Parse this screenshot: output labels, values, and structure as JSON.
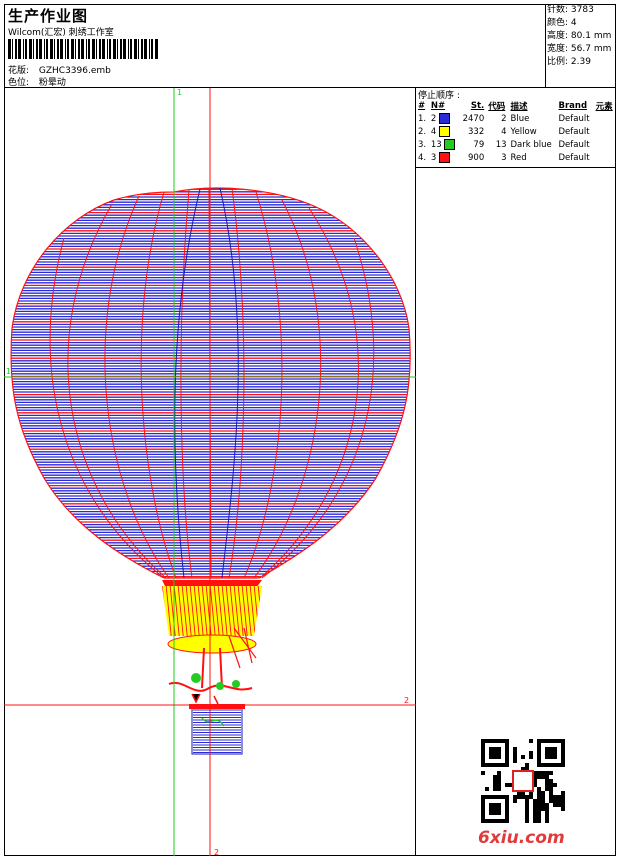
{
  "header": {
    "title": "生产作业图",
    "company": "Wilcom(汇宏) 刺绣工作室",
    "design_label": "花版:",
    "design_value": "GZHC3396.emb",
    "color_label": "色位:",
    "color_value": "粉晕动"
  },
  "stats": {
    "stitches_label": "针数:",
    "stitches_value": "3783",
    "colors_label": "颜色:",
    "colors_value": "4",
    "height_label": "高度:",
    "height_value": "80.1 mm",
    "width_label": "宽度:",
    "width_value": "56.7 mm",
    "scale_label": "比例:",
    "scale_value": "2.39"
  },
  "stop_sequence": {
    "title": "停止顺序 :",
    "headers": [
      "#",
      "N#",
      "St.",
      "代码",
      "描述",
      "Brand",
      "元素"
    ],
    "rows": [
      {
        "idx": "1.",
        "n": "2",
        "color": "#2b2bd6",
        "st": "2470",
        "code": "2",
        "desc": "Blue",
        "brand": "Default"
      },
      {
        "idx": "2.",
        "n": "4",
        "color": "#ffff00",
        "st": "332",
        "code": "4",
        "desc": "Yellow",
        "brand": "Default"
      },
      {
        "idx": "3.",
        "n": "13",
        "color": "#22cc22",
        "st": "79",
        "code": "13",
        "desc": "Dark blue",
        "brand": "Default"
      },
      {
        "idx": "4.",
        "n": "3",
        "color": "#ff1111",
        "st": "900",
        "code": "3",
        "desc": "Red",
        "brand": "Default"
      }
    ]
  },
  "axes": {
    "v1": "1",
    "h1": "1",
    "h2": "2",
    "v2": "2",
    "green": "#22cc22",
    "red": "#ff1111"
  },
  "watermark": {
    "logo": "6xiu.com"
  },
  "colors": {
    "blue": "#2b2bd6",
    "red": "#ff1111",
    "yellow": "#ffff00",
    "green": "#22cc22"
  }
}
